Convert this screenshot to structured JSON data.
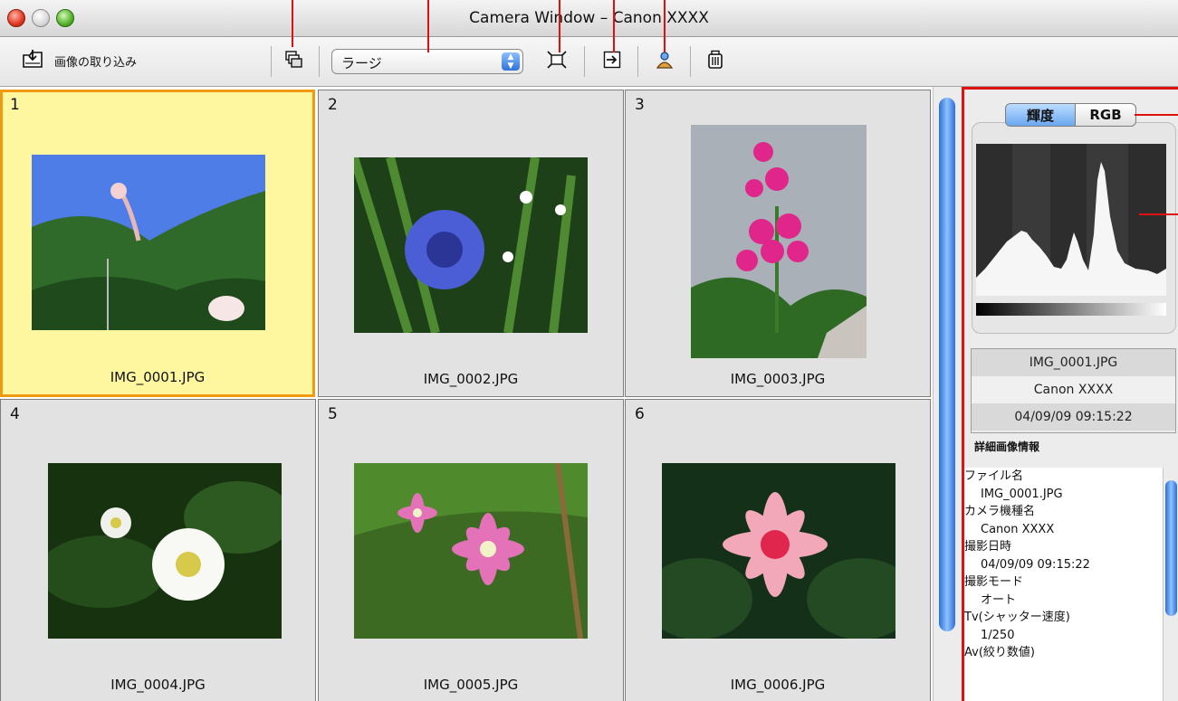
{
  "window": {
    "title": "Camera Window – Canon XXXX"
  },
  "toolbar": {
    "import_label": "画像の取り込み",
    "view_size": {
      "selected": "ラージ"
    }
  },
  "thumbnails": [
    {
      "number": "1",
      "filename": "IMG_0001.JPG",
      "selected": true
    },
    {
      "number": "2",
      "filename": "IMG_0002.JPG",
      "selected": false
    },
    {
      "number": "3",
      "filename": "IMG_0003.JPG",
      "selected": false
    },
    {
      "number": "4",
      "filename": "IMG_0004.JPG",
      "selected": false
    },
    {
      "number": "5",
      "filename": "IMG_0005.JPG",
      "selected": false
    },
    {
      "number": "6",
      "filename": "IMG_0006.JPG",
      "selected": false
    }
  ],
  "panel": {
    "histogram_tabs": [
      "輝度",
      "RGB"
    ],
    "active_tab": "輝度",
    "summary": {
      "filename": "IMG_0001.JPG",
      "camera": "Canon XXXX",
      "datetime": "04/09/09 09:15:22"
    },
    "detail_label": "詳細画像情報",
    "details": [
      {
        "label": "ファイル名",
        "value": "IMG_0001.JPG"
      },
      {
        "label": "カメラ機種名",
        "value": "Canon XXXX"
      },
      {
        "label": "撮影日時",
        "value": "04/09/09 09:15:22"
      },
      {
        "label": "撮影モード",
        "value": "オート"
      },
      {
        "label": "Tv(シャッター速度)",
        "value": "1/250"
      },
      {
        "label": "Av(絞り数値)",
        "value": ""
      }
    ]
  },
  "colors": {
    "selection_fill": "#fff7a0",
    "selection_border": "#f09a12",
    "annotation": "#e01010",
    "accent": "#2f73d8"
  }
}
